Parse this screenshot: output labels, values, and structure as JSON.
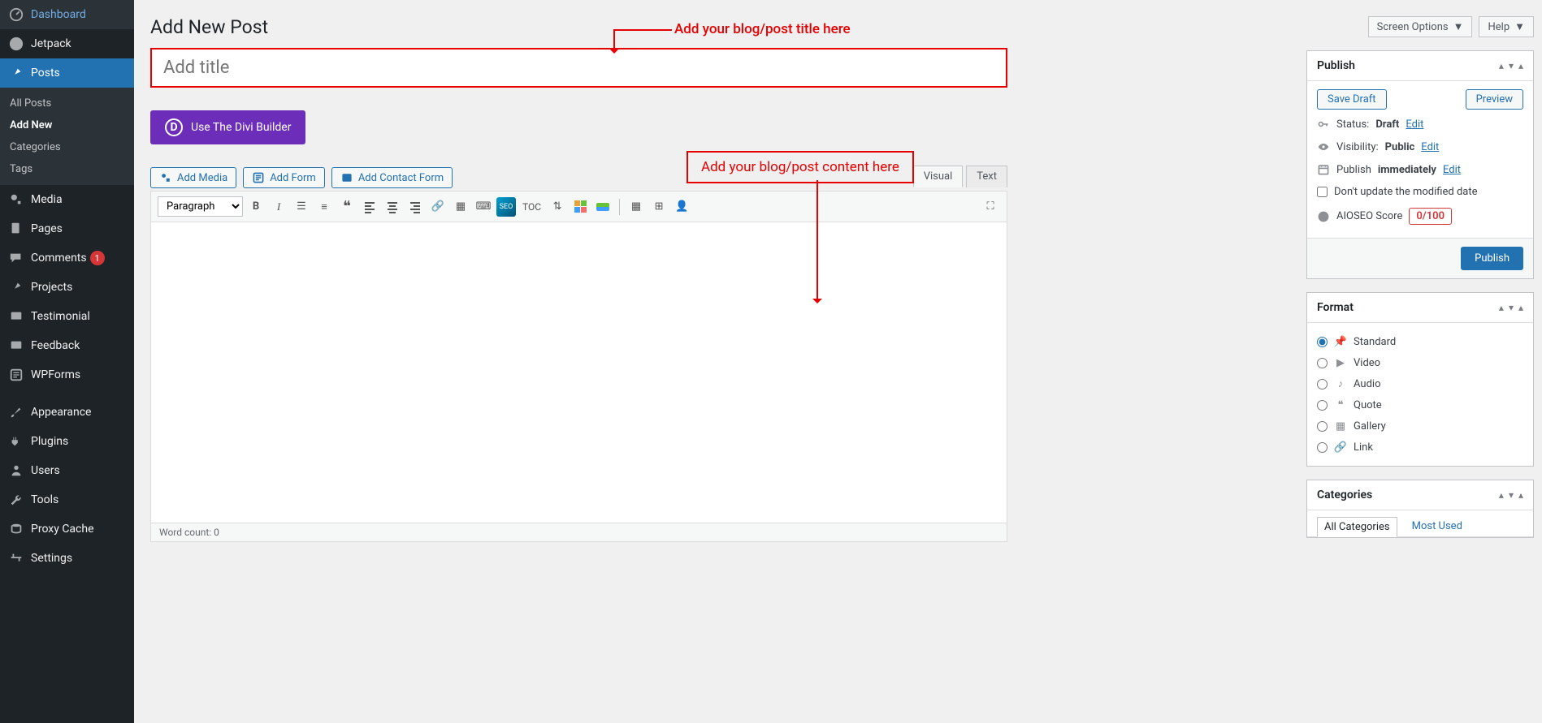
{
  "sidebar": {
    "items": [
      {
        "label": "Dashboard"
      },
      {
        "label": "Jetpack"
      },
      {
        "label": "Posts"
      },
      {
        "label": "Media"
      },
      {
        "label": "Pages"
      },
      {
        "label": "Comments",
        "badge": "1"
      },
      {
        "label": "Projects"
      },
      {
        "label": "Testimonial"
      },
      {
        "label": "Feedback"
      },
      {
        "label": "WPForms"
      },
      {
        "label": "Appearance"
      },
      {
        "label": "Plugins"
      },
      {
        "label": "Users"
      },
      {
        "label": "Tools"
      },
      {
        "label": "Proxy Cache"
      },
      {
        "label": "Settings"
      }
    ],
    "sub_posts": {
      "all": "All Posts",
      "add_new": "Add New",
      "categories": "Categories",
      "tags": "Tags"
    }
  },
  "topbar": {
    "screen_options": "Screen Options",
    "help": "Help"
  },
  "page": {
    "title": "Add New Post",
    "title_placeholder": "Add title",
    "divi_button": "Use The Divi Builder",
    "add_media": "Add Media",
    "add_form": "Add Form",
    "add_contact_form": "Add Contact Form",
    "visual_tab": "Visual",
    "text_tab": "Text",
    "paragraph": "Paragraph",
    "toc_label": "TOC",
    "word_count": "Word count: 0"
  },
  "annotations": {
    "title": "Add your blog/post title here",
    "content": "Add your blog/post content here"
  },
  "publish": {
    "heading": "Publish",
    "save_draft": "Save Draft",
    "preview": "Preview",
    "status_label": "Status:",
    "status_value": "Draft",
    "edit": "Edit",
    "visibility_label": "Visibility:",
    "visibility_value": "Public",
    "publish_label": "Publish",
    "publish_value": "immediately",
    "dont_update": "Don't update the modified date",
    "aioseo_label": "AIOSEO Score",
    "aioseo_score": "0/100",
    "publish_btn": "Publish"
  },
  "format": {
    "heading": "Format",
    "options": [
      "Standard",
      "Video",
      "Audio",
      "Quote",
      "Gallery",
      "Link"
    ]
  },
  "categories": {
    "heading": "Categories",
    "all": "All Categories",
    "most_used": "Most Used"
  }
}
